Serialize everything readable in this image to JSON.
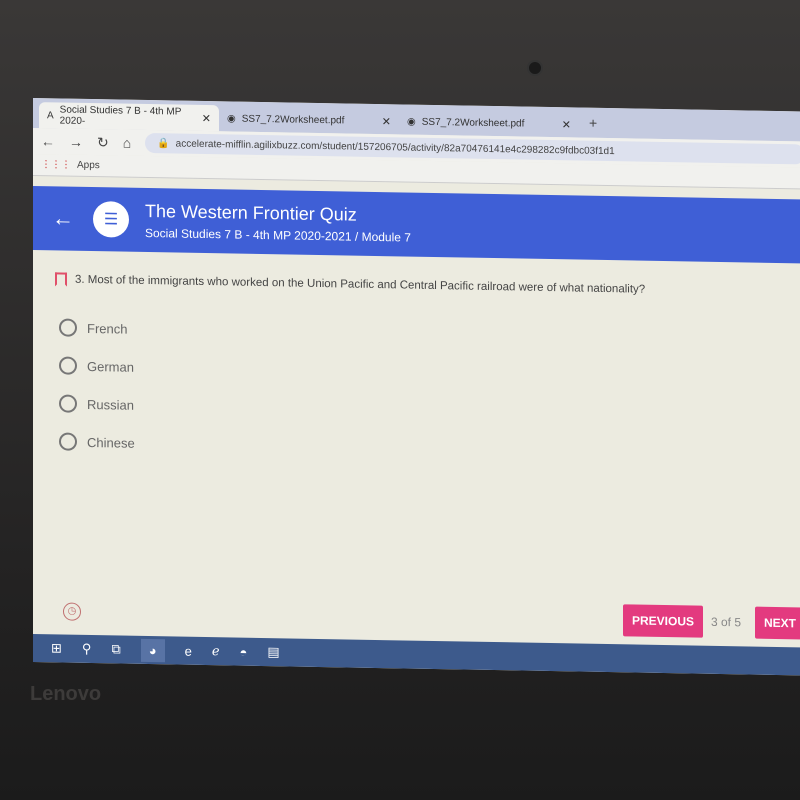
{
  "browser": {
    "tabs": [
      {
        "label": "Social Studies 7 B - 4th MP 2020-",
        "active": true
      },
      {
        "label": "SS7_7.2Worksheet.pdf",
        "active": false
      },
      {
        "label": "SS7_7.2Worksheet.pdf",
        "active": false
      }
    ],
    "url": "accelerate-mifflin.agilixbuzz.com/student/157206705/activity/82a70476141e4c298282c9fdbc03f1d1",
    "bookmarks_apps": "Apps"
  },
  "header": {
    "title": "The Western Frontier Quiz",
    "subtitle": "Social Studies 7 B - 4th MP 2020-2021 / Module 7"
  },
  "question": {
    "text": "3. Most of the immigrants who worked on the Union Pacific and Central Pacific railroad were of what nationality?",
    "options": [
      "French",
      "German",
      "Russian",
      "Chinese"
    ]
  },
  "footer": {
    "previous": "PREVIOUS",
    "count": "3 of 5",
    "next": "NEXT"
  },
  "brand": "Lenovo",
  "colors": {
    "header": "#3f5fd6",
    "button": "#e33a7f",
    "taskbar": "#3d5a8c"
  }
}
